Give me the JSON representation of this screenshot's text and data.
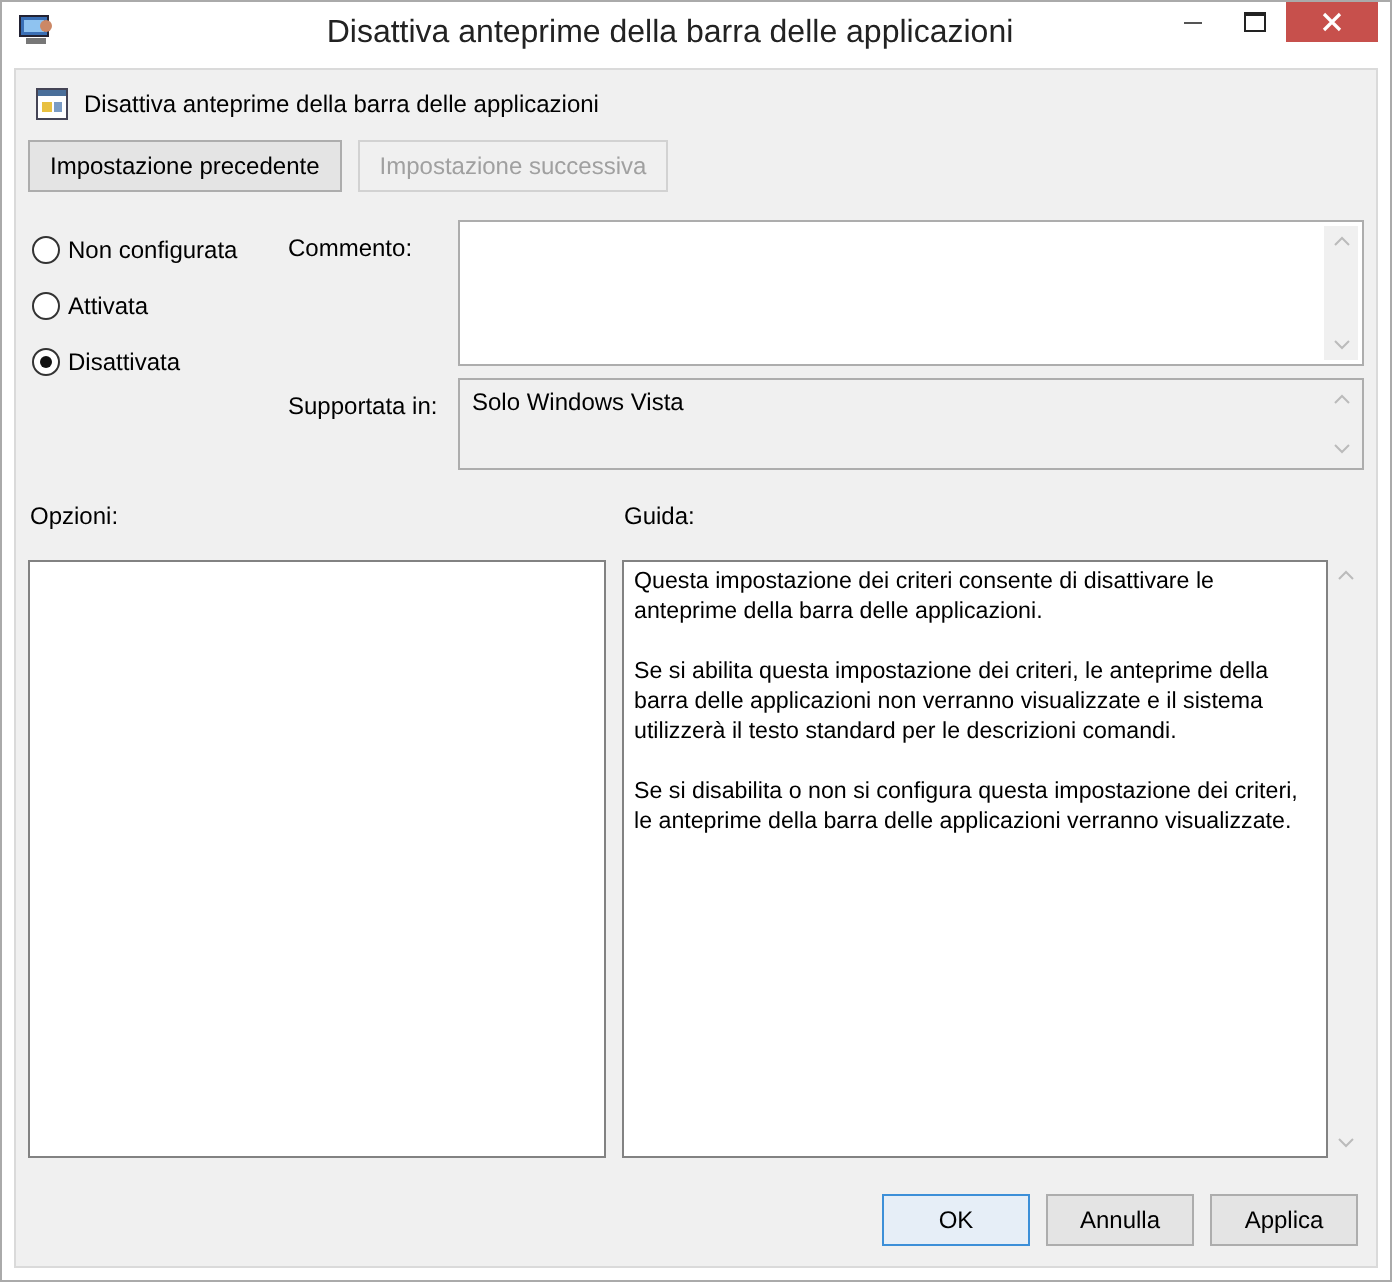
{
  "window": {
    "title": "Disattiva anteprime della barra delle applicazioni"
  },
  "header": {
    "title": "Disattiva anteprime della barra delle applicazioni"
  },
  "nav_buttons": [
    {
      "label": "Impostazione precedente",
      "disabled": false
    },
    {
      "label": "Impostazione successiva",
      "disabled": true
    }
  ],
  "state_options": [
    {
      "label": "Non configurata",
      "selected": false
    },
    {
      "label": "Attivata",
      "selected": false
    },
    {
      "label": "Disattivata",
      "selected": true
    }
  ],
  "comment": {
    "label": "Commento:"
  },
  "supported_on": {
    "label": "Supportata in:",
    "value": "Solo Windows Vista"
  },
  "options": {
    "label": "Opzioni:"
  },
  "help": {
    "label": "Guida:",
    "paragraphs": [
      "Questa impostazione dei criteri consente di disattivare le anteprime della barra delle applicazioni.",
      "Se si abilita questa impostazione dei criteri, le anteprime della barra delle applicazioni non verranno visualizzate e il sistema utilizzerà il testo standard per le descrizioni comandi.",
      "Se si disabilita o non si configura questa impostazione dei criteri, le anteprime della barra delle applicazioni verranno visualizzate."
    ]
  },
  "buttons": [
    {
      "label": "OK",
      "default": true
    },
    {
      "label": "Annulla",
      "default": false
    },
    {
      "label": "Applica",
      "default": false
    }
  ]
}
